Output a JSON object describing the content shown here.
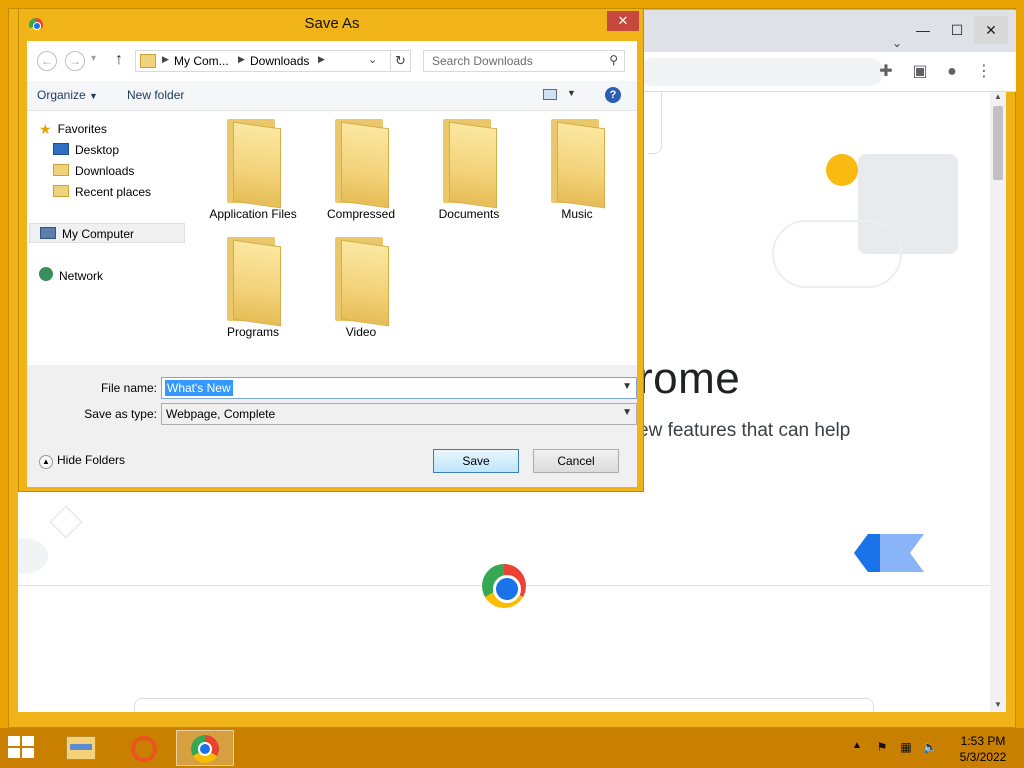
{
  "dialog": {
    "title": "Save As",
    "close_glyph": "✕",
    "address": {
      "seg1": "My Com...",
      "seg2": "Downloads"
    },
    "search_placeholder": "Search Downloads",
    "toolbar": {
      "organize": "Organize",
      "new_folder": "New folder"
    },
    "nav": {
      "favorites": "Favorites",
      "desktop": "Desktop",
      "downloads": "Downloads",
      "recent": "Recent places",
      "my_computer": "My Computer",
      "network": "Network"
    },
    "folders": [
      "Application Files",
      "Compressed",
      "Documents",
      "Music",
      "Programs",
      "Video"
    ],
    "file_name_label": "File name:",
    "file_name_value": "What's New",
    "save_as_type_label": "Save as type:",
    "save_as_type_value": "Webpage, Complete",
    "hide_folders": "Hide Folders",
    "save_button": "Save",
    "cancel_button": "Cancel"
  },
  "browser": {
    "headline_fragment": "rome",
    "subline_fragment": "ew features that can help",
    "colors": {
      "brand_blue": "#1a73e8",
      "brand_red": "#ea4335",
      "brand_yellow": "#fbbc04",
      "brand_green": "#34a853"
    }
  },
  "taskbar": {
    "time": "1:53 PM",
    "date": "5/3/2022",
    "apps": [
      "start-icon",
      "file-explorer-icon",
      "ubuntu-icon",
      "chrome-icon"
    ]
  },
  "theme": {
    "accent": "#f0b418",
    "taskbar": "#c97f00"
  }
}
